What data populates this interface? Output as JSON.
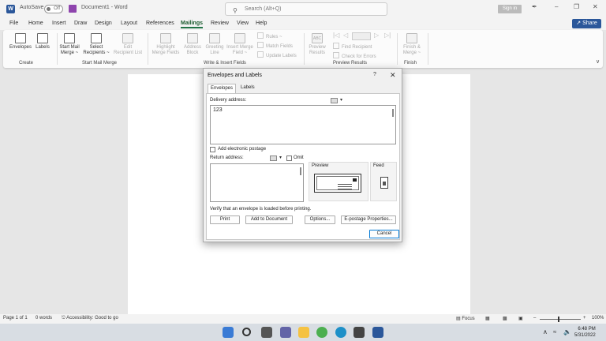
{
  "titlebar": {
    "app_logo": "W",
    "autosave_label": "AutoSave",
    "autosave_state": "Off",
    "document_title": "Document1 - Word",
    "search_placeholder": "Search (Alt+Q)",
    "signin_label": "Sign in",
    "pen_icon": "✒",
    "minimize": "–",
    "restore": "❐",
    "close": "✕"
  },
  "menu": {
    "items": [
      "File",
      "Home",
      "Insert",
      "Draw",
      "Design",
      "Layout",
      "References",
      "Mailings",
      "Review",
      "View",
      "Help"
    ],
    "active": "Mailings",
    "share_label": "Share"
  },
  "ribbon": {
    "create": {
      "label": "Create",
      "envelopes": "Envelopes",
      "labels": "Labels"
    },
    "start_mail_merge": {
      "label": "Start Mail Merge",
      "start_mail_merge_1": "Start Mail",
      "start_mail_merge_2": "Merge ~",
      "select_recipients_1": "Select",
      "select_recipients_2": "Recipients ~",
      "edit_recipient_1": "Edit",
      "edit_recipient_2": "Recipient List"
    },
    "write_insert": {
      "label": "Write & Insert Fields",
      "highlight_1": "Highlight",
      "highlight_2": "Merge Fields",
      "address_1": "Address",
      "address_2": "Block",
      "greeting_1": "Greeting",
      "greeting_2": "Line",
      "insert_merge_1": "Insert Merge",
      "insert_merge_2": "Field ~",
      "rules": "Rules ~",
      "match_fields": "Match Fields",
      "update_labels": "Update Labels"
    },
    "preview": {
      "label": "Preview Results",
      "preview_1": "Preview",
      "preview_2": "Results",
      "abc": "ABC",
      "find_recipient": "Find Recipient",
      "check_errors": "Check for Errors",
      "first": "|◁",
      "prev": "◁",
      "next": "▷",
      "last": "▷|"
    },
    "finish": {
      "label": "Finish",
      "finish_1": "Finish &",
      "finish_2": "Merge ~"
    },
    "collapse_icon": "∨"
  },
  "dialog": {
    "title": "Envelopes and Labels",
    "help": "?",
    "close": "✕",
    "tabs": [
      "Envelopes",
      "Labels"
    ],
    "delivery_label": "Delivery address:",
    "delivery_value": "123",
    "add_postage_label": "Add electronic postage",
    "return_label": "Return address:",
    "omit_label": "Omit",
    "preview_label": "Preview",
    "feed_label": "Feed",
    "verify_text": "Verify that an envelope is loaded before printing.",
    "buttons": {
      "print": "Print",
      "add_to_document": "Add to Document",
      "options": "Options...",
      "epostage": "E-postage Properties...",
      "cancel": "Cancel"
    }
  },
  "status": {
    "page": "Page 1 of 1",
    "words": "0 words",
    "accessibility": "Accessibility: Good to go",
    "focus": "Focus",
    "zoom": "100%",
    "zoom_fraction": 0.5
  },
  "taskbar": {
    "time": "6:48 PM",
    "date": "5/31/2022",
    "tray_chevron": "∧"
  }
}
